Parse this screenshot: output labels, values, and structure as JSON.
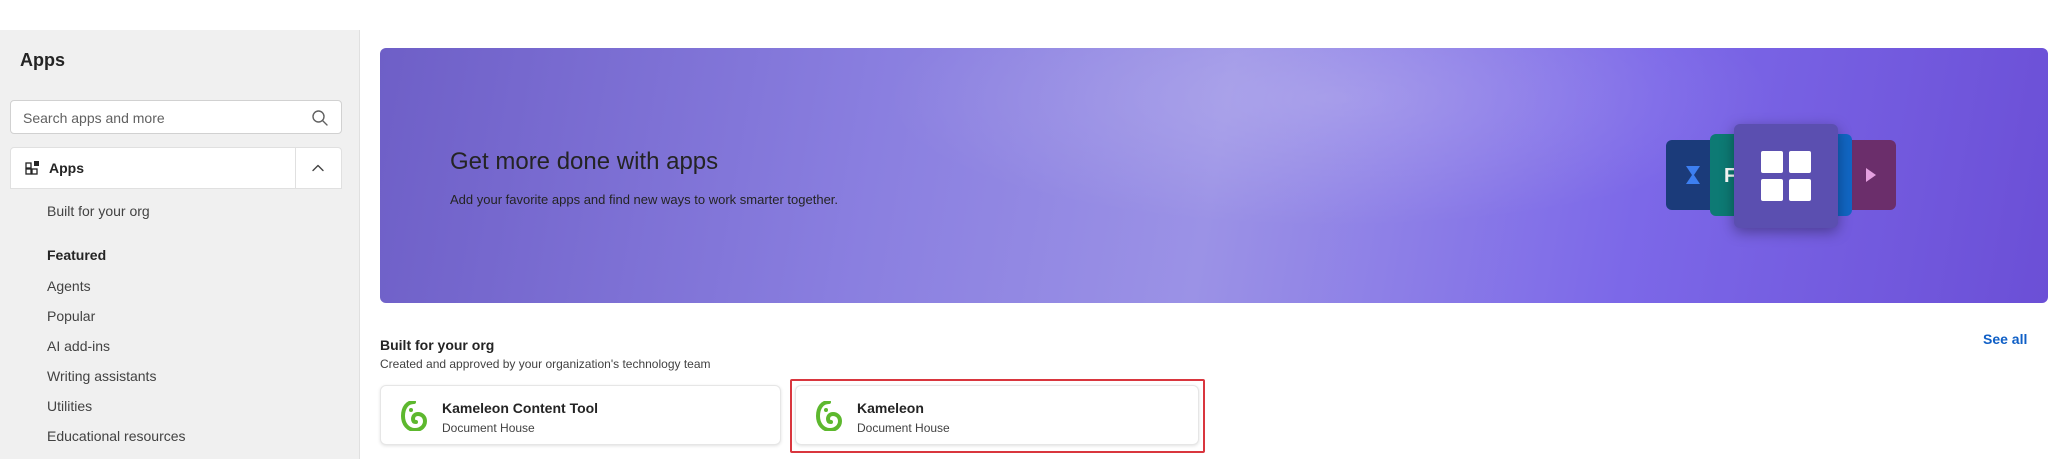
{
  "sidebar": {
    "title": "Apps",
    "search_placeholder": "Search apps and more",
    "apps_section_label": "Apps",
    "items": [
      {
        "label": "Built for your org"
      },
      {
        "label": "Featured",
        "heading": true
      },
      {
        "label": "Agents"
      },
      {
        "label": "Popular"
      },
      {
        "label": "AI add-ins"
      },
      {
        "label": "Writing assistants"
      },
      {
        "label": "Utilities"
      },
      {
        "label": "Educational resources"
      }
    ]
  },
  "hero": {
    "title": "Get more done with apps",
    "subtitle": "Add your favorite apps and find new ways to work smarter together."
  },
  "section": {
    "title": "Built for your org",
    "subtitle": "Created and approved by your organization's technology team",
    "see_all": "See all"
  },
  "cards": [
    {
      "name": "Kameleon Content Tool",
      "publisher": "Document House"
    },
    {
      "name": "Kameleon",
      "publisher": "Document House"
    }
  ],
  "colors": {
    "accent_link": "#0f5fc6",
    "highlight": "#d9363e",
    "logo_green": "#5db82e"
  }
}
